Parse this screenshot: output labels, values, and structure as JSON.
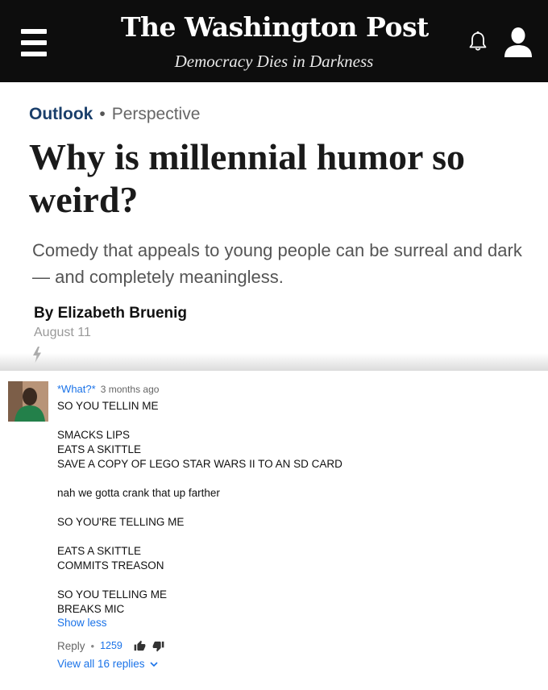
{
  "header": {
    "masthead": "The Washington Post",
    "tagline": "Democracy Dies in Darkness",
    "icons": [
      "menu-icon",
      "bell-icon",
      "user-icon"
    ],
    "background": "#0d0d0d"
  },
  "article": {
    "section": "Outlook",
    "separator": "•",
    "type": "Perspective",
    "headline": "Why is millennial humor so weird?",
    "dek": "Comedy that appeals to young people can be surreal and dark — and completely meaningless.",
    "byline": "By Elizabeth Bruenig",
    "date": "August 11",
    "accent": "#1a3f6b"
  },
  "comment": {
    "author": "*What?*",
    "time": "3 months ago",
    "paragraphs": [
      [
        "SO YOU TELLIN ME"
      ],
      [
        "SMACKS LIPS",
        "EATS A SKITTLE",
        "SAVE A COPY OF LEGO STAR WARS II TO AN SD CARD"
      ],
      [
        "nah we gotta crank that up farther"
      ],
      [
        "SO YOU'RE TELLING ME"
      ],
      [
        "EATS A SKITTLE",
        "COMMITS TREASON"
      ],
      [
        "SO YOU TELLING ME",
        "BREAKS MIC"
      ]
    ],
    "show_less": "Show less",
    "reply": "Reply",
    "dot": "•",
    "likes": "1259",
    "view_replies": "View all 16 replies",
    "link_color": "#1b73e8"
  }
}
